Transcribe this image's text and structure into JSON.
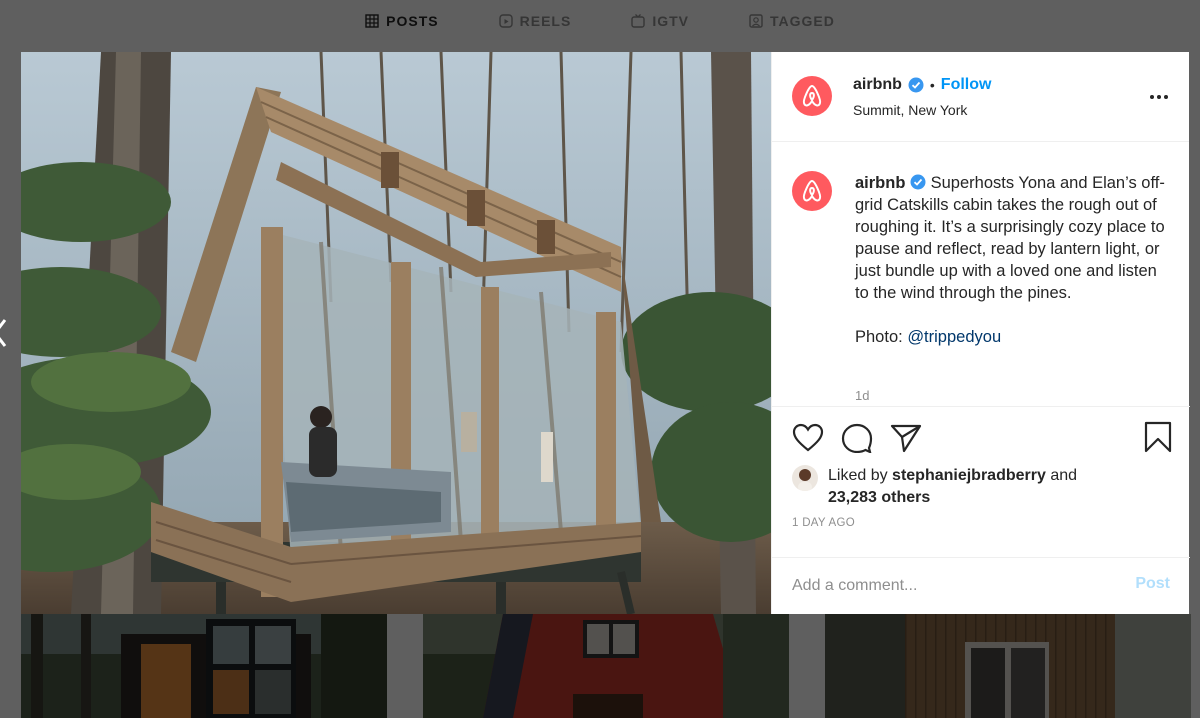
{
  "tabs": [
    {
      "label": "POSTS",
      "icon": "grid-icon"
    },
    {
      "label": "REELS",
      "icon": "reels-icon"
    },
    {
      "label": "IGTV",
      "icon": "igtv-icon"
    },
    {
      "label": "TAGGED",
      "icon": "tagged-icon"
    }
  ],
  "post": {
    "username": "airbnb",
    "separator": "•",
    "follow_label": "Follow",
    "location": "Summit, New York",
    "more_icon": "more-options-icon",
    "caption_user": "airbnb",
    "caption_text": "Superhosts Yona and Elan’s off-grid Catskills cabin takes the rough out of roughing it. It’s a surprisingly cozy place to pause and reflect, read by lantern light, or just bundle up with a loved one and listen to the wind through the pines.",
    "photo_label": "Photo:",
    "photo_credit": "@trippedyou",
    "age": "1d",
    "liked_by_prefix": "Liked by",
    "liked_by_user": "stephaniejbradberry",
    "liked_by_and": "and",
    "liked_by_others": "23,283 others",
    "date": "1 DAY AGO",
    "comment_placeholder": "Add a comment...",
    "post_label": "Post"
  },
  "colors": {
    "brand": "#ff5a5f",
    "link": "#0095f6",
    "verified": "#3897f0",
    "post_disabled": "#b2dffc"
  }
}
